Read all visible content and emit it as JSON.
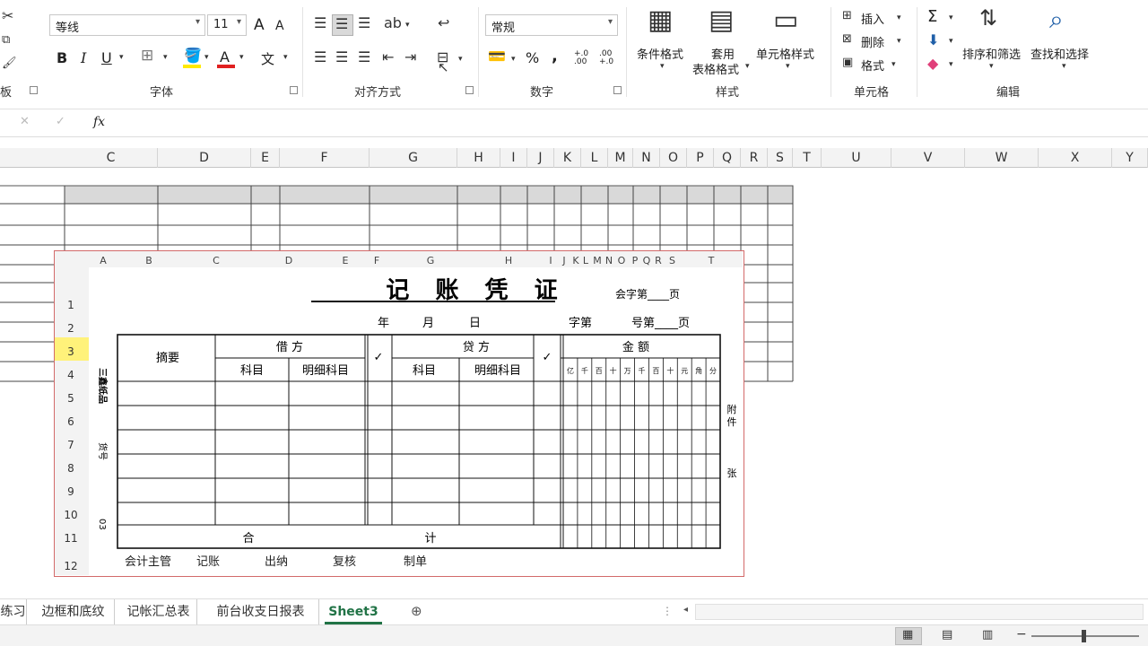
{
  "ribbon": {
    "font_name": "等线",
    "font_size": "11",
    "grow_font": "A",
    "shrink_font": "A",
    "bold": "B",
    "italic": "I",
    "underline": "U",
    "font_color_letter": "A",
    "wen": "文",
    "number_format": "常规",
    "percent": "%",
    "comma": ",",
    "inc_decimal": "+.0 .00",
    "dec_decimal": ".00 +.0",
    "cond_format": "条件格式",
    "table_format_1": "套用",
    "table_format_2": "表格格式",
    "cell_style": "单元格样式",
    "insert": "插入",
    "delete": "删除",
    "format": "格式",
    "sigma": "Σ",
    "sort_filter": "排序和筛选",
    "find_select": "查找和选择",
    "groups": {
      "clipboard_tail": "板",
      "font": "字体",
      "alignment": "对齐方式",
      "number": "数字",
      "styles": "样式",
      "cells": "单元格",
      "editing": "编辑"
    }
  },
  "formula_bar": {
    "fx": "fx"
  },
  "columns": {
    "sheet": [
      "C",
      "D",
      "E",
      "F",
      "G",
      "H",
      "I",
      "J",
      "K",
      "L",
      "M",
      "N",
      "O",
      "P",
      "Q",
      "R",
      "S",
      "T",
      "U",
      "V",
      "W",
      "X",
      "Y"
    ],
    "preview": [
      "A",
      "B",
      "C",
      "D",
      "E",
      "F",
      "G",
      "H",
      "I",
      "J",
      "K",
      "L",
      "M",
      "N",
      "O",
      "P",
      "Q",
      "R",
      "S",
      "T"
    ]
  },
  "preview_rows": [
    "1",
    "2",
    "3",
    "4",
    "5",
    "6",
    "7",
    "8",
    "9",
    "10",
    "11",
    "12"
  ],
  "voucher": {
    "title": "记 账 凭 证",
    "accounting_no": "会字第____页",
    "year": "年",
    "month": "月",
    "day": "日",
    "zi_di": "字第",
    "hao_di": "号第____页",
    "summary": "摘要",
    "debit": "借 方",
    "credit": "贷 方",
    "amount": "金 额",
    "subject": "科目",
    "detail_subject": "明细科目",
    "check": "✓",
    "digits": [
      "亿",
      "千",
      "百",
      "十",
      "万",
      "千",
      "百",
      "十",
      "元",
      "角",
      "分"
    ],
    "total_left": "合",
    "total_right": "计",
    "attach_1": "附",
    "attach_2": "件",
    "attach_3": "张",
    "side_1": "三鑫纸品",
    "side_2": "货号",
    "side_3": "03",
    "footer": [
      "会计主管",
      "记账",
      "出纳",
      "复核",
      "制单"
    ]
  },
  "tabs": [
    "练习",
    "边框和底纹",
    "记帐汇总表",
    "前台收支日报表",
    "Sheet3"
  ],
  "active_tab": "Sheet3",
  "colors": {
    "accent_green": "#217346",
    "voucher_border": "#d36a6a",
    "selected_row": "#fff27a"
  }
}
